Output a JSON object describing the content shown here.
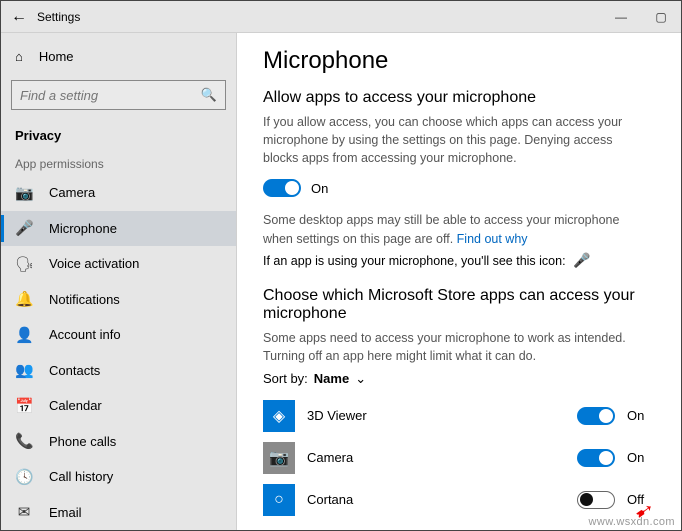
{
  "window": {
    "title": "Settings",
    "min": "—",
    "max": "▢",
    "back": "←"
  },
  "sidebar": {
    "home_label": "Home",
    "search_placeholder": "Find a setting",
    "section": "Privacy",
    "group": "App permissions",
    "items": [
      {
        "icon": "📷",
        "label": "Camera"
      },
      {
        "icon": "🎤",
        "label": "Microphone"
      },
      {
        "icon": "🗣",
        "label": "Voice activation"
      },
      {
        "icon": "🔔",
        "label": "Notifications"
      },
      {
        "icon": "👤",
        "label": "Account info"
      },
      {
        "icon": "👥",
        "label": "Contacts"
      },
      {
        "icon": "📅",
        "label": "Calendar"
      },
      {
        "icon": "📞",
        "label": "Phone calls"
      },
      {
        "icon": "🕓",
        "label": "Call history"
      },
      {
        "icon": "✉",
        "label": "Email"
      }
    ]
  },
  "main": {
    "title": "Microphone",
    "allow_heading": "Allow apps to access your microphone",
    "allow_desc": "If you allow access, you can choose which apps can access your microphone by using the settings on this page. Denying access blocks apps from accessing your microphone.",
    "allow_state": "On",
    "desktop_note": "Some desktop apps may still be able to access your microphone when settings on this page are off. ",
    "find_out": "Find out why",
    "in_use_note": "If an app is using your microphone, you'll see this icon:",
    "choose_heading": "Choose which Microsoft Store apps can access your microphone",
    "choose_desc": "Some apps need to access your microphone to work as intended. Turning off an app here might limit what it can do.",
    "sort_label": "Sort by:",
    "sort_value": "Name",
    "apps": [
      {
        "tile_color": "blue",
        "glyph": "◈",
        "name": "3D Viewer",
        "on": true,
        "state": "On"
      },
      {
        "tile_color": "gray",
        "glyph": "📷",
        "name": "Camera",
        "on": true,
        "state": "On"
      },
      {
        "tile_color": "blue",
        "glyph": "○",
        "name": "Cortana",
        "on": false,
        "state": "Off"
      }
    ]
  },
  "watermark": "www.wsxdn.com"
}
